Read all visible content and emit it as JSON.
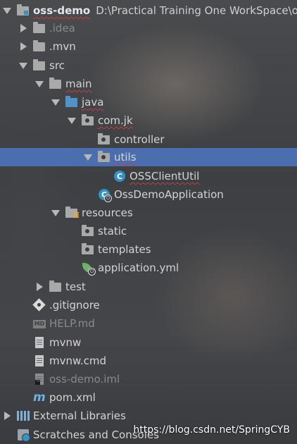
{
  "project": {
    "name": "oss-demo",
    "path": "D:\\Practical Training One WorkSpace\\oss"
  },
  "tree": {
    "idea": ".idea",
    "mvn": ".mvn",
    "src": "src",
    "main": "main",
    "java": "java",
    "package": "com.jk",
    "controller": "controller",
    "utils": "utils",
    "oss_client_util": "OSSClientUtil",
    "oss_demo_application": "OssDemoApplication",
    "resources": "resources",
    "static": "static",
    "templates": "templates",
    "application_yml": "application.yml",
    "test": "test",
    "gitignore": ".gitignore",
    "help_md": "HELP.md",
    "mvnw": "mvnw",
    "mvnw_cmd": "mvnw.cmd",
    "oss_demo_iml": "oss-demo.iml",
    "pom_xml": "pom.xml",
    "external_libraries": "External Libraries",
    "scratches": "Scratches and Consoles"
  },
  "icons": {
    "class_letter": "C",
    "md_badge": "MD",
    "maven": "m"
  },
  "watermark": "https://blog.csdn.net/SpringCYB",
  "colors": {
    "selection": "#4b6eaf",
    "source_folder": "#4f93c9",
    "class_icon": "#3592c4"
  }
}
